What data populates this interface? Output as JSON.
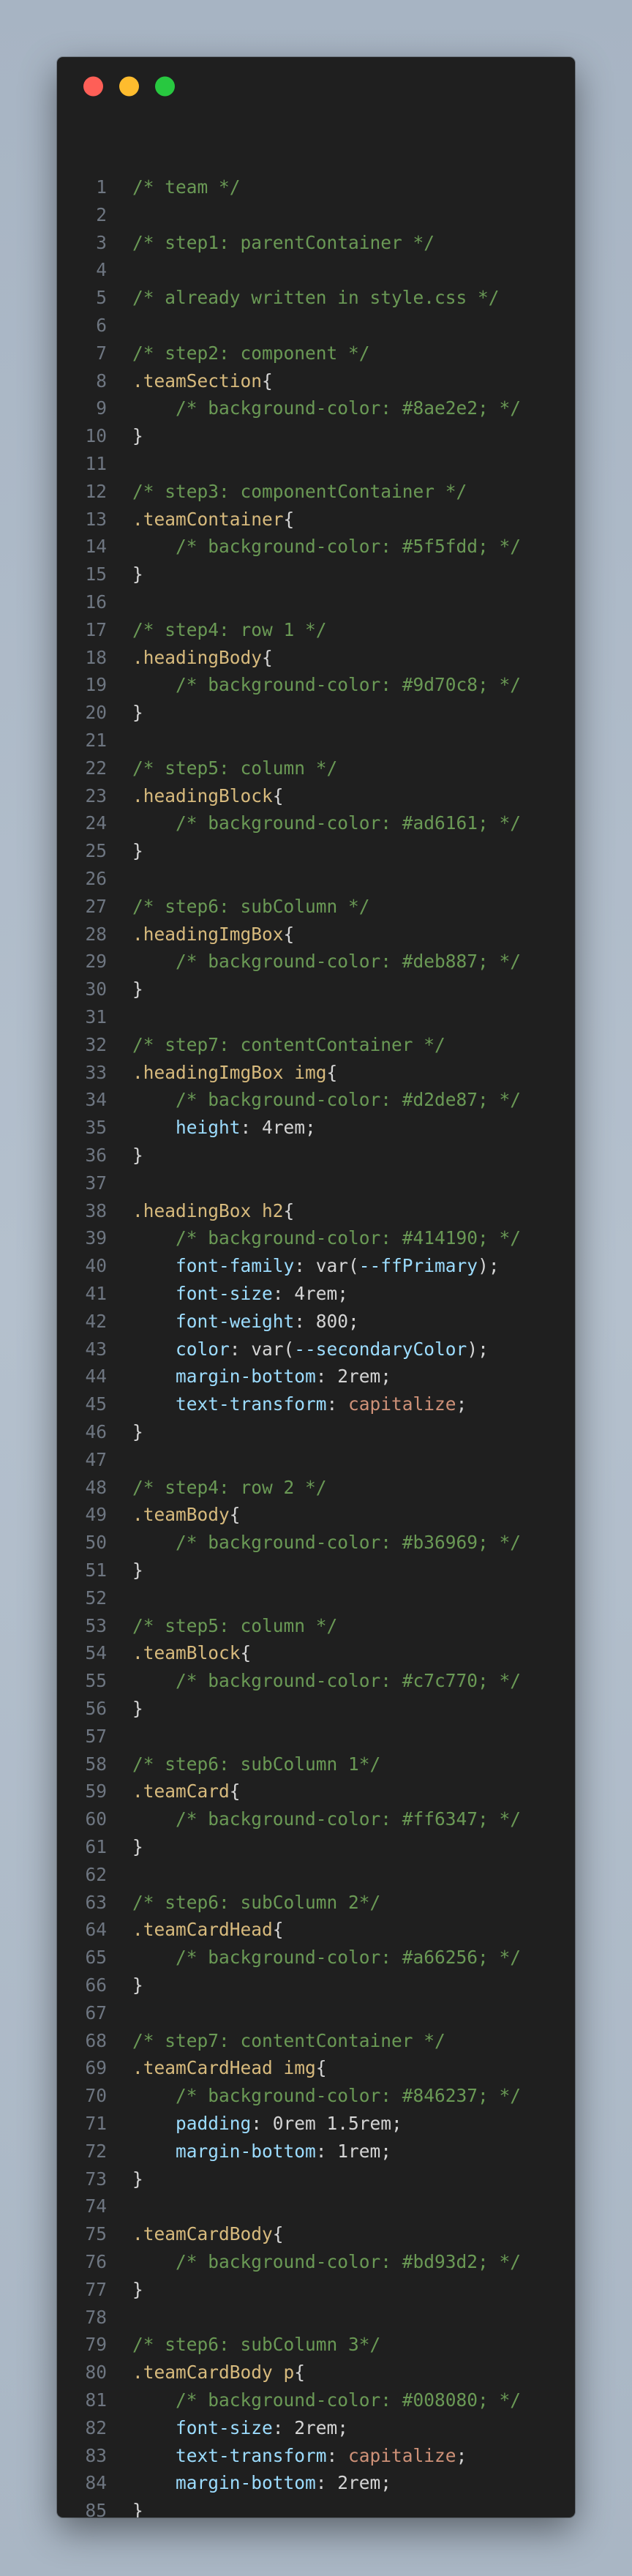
{
  "window": {
    "controls": [
      {
        "name": "close",
        "color": "#fe5f57"
      },
      {
        "name": "minimize",
        "color": "#febc2e"
      },
      {
        "name": "maximize",
        "color": "#28c840"
      }
    ]
  },
  "colors": {
    "comment": "#6a9955",
    "selector": "#d7ba7d",
    "property": "#9cdcfe",
    "keyword": "#ce9178",
    "text": "#d4d4d4",
    "line_number": "#6e7681"
  },
  "code": {
    "lines": [
      {
        "n": "1",
        "tokens": [
          {
            "t": "/* team */",
            "c": "comment"
          }
        ]
      },
      {
        "n": "2",
        "tokens": []
      },
      {
        "n": "3",
        "tokens": [
          {
            "t": "/* step1: parentContainer */",
            "c": "comment"
          }
        ]
      },
      {
        "n": "4",
        "tokens": []
      },
      {
        "n": "5",
        "tokens": [
          {
            "t": "/* already written in style.css */",
            "c": "comment"
          }
        ]
      },
      {
        "n": "6",
        "tokens": []
      },
      {
        "n": "7",
        "tokens": [
          {
            "t": "/* step2: component */",
            "c": "comment"
          }
        ]
      },
      {
        "n": "8",
        "tokens": [
          {
            "t": ".teamSection",
            "c": "selector"
          },
          {
            "t": "{",
            "c": "brace"
          }
        ]
      },
      {
        "n": "9",
        "tokens": [
          {
            "t": "    ",
            "c": "punct"
          },
          {
            "t": "/* background-color: #8ae2e2; */",
            "c": "comment"
          }
        ]
      },
      {
        "n": "10",
        "tokens": [
          {
            "t": "}",
            "c": "brace"
          }
        ]
      },
      {
        "n": "11",
        "tokens": []
      },
      {
        "n": "12",
        "tokens": [
          {
            "t": "/* step3: componentContainer */",
            "c": "comment"
          }
        ]
      },
      {
        "n": "13",
        "tokens": [
          {
            "t": ".teamContainer",
            "c": "selector"
          },
          {
            "t": "{",
            "c": "brace"
          }
        ]
      },
      {
        "n": "14",
        "tokens": [
          {
            "t": "    ",
            "c": "punct"
          },
          {
            "t": "/* background-color: #5f5fdd; */",
            "c": "comment"
          }
        ]
      },
      {
        "n": "15",
        "tokens": [
          {
            "t": "}",
            "c": "brace"
          }
        ]
      },
      {
        "n": "16",
        "tokens": []
      },
      {
        "n": "17",
        "tokens": [
          {
            "t": "/* step4: row 1 */",
            "c": "comment"
          }
        ]
      },
      {
        "n": "18",
        "tokens": [
          {
            "t": ".headingBody",
            "c": "selector"
          },
          {
            "t": "{",
            "c": "brace"
          }
        ]
      },
      {
        "n": "19",
        "tokens": [
          {
            "t": "    ",
            "c": "punct"
          },
          {
            "t": "/* background-color: #9d70c8; */",
            "c": "comment"
          }
        ]
      },
      {
        "n": "20",
        "tokens": [
          {
            "t": "}",
            "c": "brace"
          }
        ]
      },
      {
        "n": "21",
        "tokens": []
      },
      {
        "n": "22",
        "tokens": [
          {
            "t": "/* step5: column */",
            "c": "comment"
          }
        ]
      },
      {
        "n": "23",
        "tokens": [
          {
            "t": ".headingBlock",
            "c": "selector"
          },
          {
            "t": "{",
            "c": "brace"
          }
        ]
      },
      {
        "n": "24",
        "tokens": [
          {
            "t": "    ",
            "c": "punct"
          },
          {
            "t": "/* background-color: #ad6161; */",
            "c": "comment"
          }
        ]
      },
      {
        "n": "25",
        "tokens": [
          {
            "t": "}",
            "c": "brace"
          }
        ]
      },
      {
        "n": "26",
        "tokens": []
      },
      {
        "n": "27",
        "tokens": [
          {
            "t": "/* step6: subColumn */",
            "c": "comment"
          }
        ]
      },
      {
        "n": "28",
        "tokens": [
          {
            "t": ".headingImgBox",
            "c": "selector"
          },
          {
            "t": "{",
            "c": "brace"
          }
        ]
      },
      {
        "n": "29",
        "tokens": [
          {
            "t": "    ",
            "c": "punct"
          },
          {
            "t": "/* background-color: #deb887; */",
            "c": "comment"
          }
        ]
      },
      {
        "n": "30",
        "tokens": [
          {
            "t": "}",
            "c": "brace"
          }
        ]
      },
      {
        "n": "31",
        "tokens": []
      },
      {
        "n": "32",
        "tokens": [
          {
            "t": "/* step7: contentContainer */",
            "c": "comment"
          }
        ]
      },
      {
        "n": "33",
        "tokens": [
          {
            "t": ".headingImgBox img",
            "c": "selector"
          },
          {
            "t": "{",
            "c": "brace"
          }
        ]
      },
      {
        "n": "34",
        "tokens": [
          {
            "t": "    ",
            "c": "punct"
          },
          {
            "t": "/* background-color: #d2de87; */",
            "c": "comment"
          }
        ]
      },
      {
        "n": "35",
        "tokens": [
          {
            "t": "    ",
            "c": "punct"
          },
          {
            "t": "height",
            "c": "prop"
          },
          {
            "t": ": 4rem;",
            "c": "value"
          }
        ]
      },
      {
        "n": "36",
        "tokens": [
          {
            "t": "}",
            "c": "brace"
          }
        ]
      },
      {
        "n": "37",
        "tokens": []
      },
      {
        "n": "38",
        "tokens": [
          {
            "t": ".headingBox h2",
            "c": "selector"
          },
          {
            "t": "{",
            "c": "brace"
          }
        ]
      },
      {
        "n": "39",
        "tokens": [
          {
            "t": "    ",
            "c": "punct"
          },
          {
            "t": "/* background-color: #414190; */",
            "c": "comment"
          }
        ]
      },
      {
        "n": "40",
        "tokens": [
          {
            "t": "    ",
            "c": "punct"
          },
          {
            "t": "font-family",
            "c": "prop"
          },
          {
            "t": ": var(",
            "c": "value"
          },
          {
            "t": "--ffPrimary",
            "c": "var"
          },
          {
            "t": ");",
            "c": "value"
          }
        ]
      },
      {
        "n": "41",
        "tokens": [
          {
            "t": "    ",
            "c": "punct"
          },
          {
            "t": "font-size",
            "c": "prop"
          },
          {
            "t": ": 4rem;",
            "c": "value"
          }
        ]
      },
      {
        "n": "42",
        "tokens": [
          {
            "t": "    ",
            "c": "punct"
          },
          {
            "t": "font-weight",
            "c": "prop"
          },
          {
            "t": ": 800;",
            "c": "value"
          }
        ]
      },
      {
        "n": "43",
        "tokens": [
          {
            "t": "    ",
            "c": "punct"
          },
          {
            "t": "color",
            "c": "prop"
          },
          {
            "t": ": var(",
            "c": "value"
          },
          {
            "t": "--secondaryColor",
            "c": "var"
          },
          {
            "t": ");",
            "c": "value"
          }
        ]
      },
      {
        "n": "44",
        "tokens": [
          {
            "t": "    ",
            "c": "punct"
          },
          {
            "t": "margin-bottom",
            "c": "prop"
          },
          {
            "t": ": 2rem;",
            "c": "value"
          }
        ]
      },
      {
        "n": "45",
        "tokens": [
          {
            "t": "    ",
            "c": "punct"
          },
          {
            "t": "text-transform",
            "c": "prop"
          },
          {
            "t": ": ",
            "c": "value"
          },
          {
            "t": "capitalize",
            "c": "keyword"
          },
          {
            "t": ";",
            "c": "value"
          }
        ]
      },
      {
        "n": "46",
        "tokens": [
          {
            "t": "}",
            "c": "brace"
          }
        ]
      },
      {
        "n": "47",
        "tokens": []
      },
      {
        "n": "48",
        "tokens": [
          {
            "t": "/* step4: row 2 */",
            "c": "comment"
          }
        ]
      },
      {
        "n": "49",
        "tokens": [
          {
            "t": ".teamBody",
            "c": "selector"
          },
          {
            "t": "{",
            "c": "brace"
          }
        ]
      },
      {
        "n": "50",
        "tokens": [
          {
            "t": "    ",
            "c": "punct"
          },
          {
            "t": "/* background-color: #b36969; */",
            "c": "comment"
          }
        ]
      },
      {
        "n": "51",
        "tokens": [
          {
            "t": "}",
            "c": "brace"
          }
        ]
      },
      {
        "n": "52",
        "tokens": []
      },
      {
        "n": "53",
        "tokens": [
          {
            "t": "/* step5: column */",
            "c": "comment"
          }
        ]
      },
      {
        "n": "54",
        "tokens": [
          {
            "t": ".teamBlock",
            "c": "selector"
          },
          {
            "t": "{",
            "c": "brace"
          }
        ]
      },
      {
        "n": "55",
        "tokens": [
          {
            "t": "    ",
            "c": "punct"
          },
          {
            "t": "/* background-color: #c7c770; */",
            "c": "comment"
          }
        ]
      },
      {
        "n": "56",
        "tokens": [
          {
            "t": "}",
            "c": "brace"
          }
        ]
      },
      {
        "n": "57",
        "tokens": []
      },
      {
        "n": "58",
        "tokens": [
          {
            "t": "/* step6: subColumn 1*/",
            "c": "comment"
          }
        ]
      },
      {
        "n": "59",
        "tokens": [
          {
            "t": ".teamCard",
            "c": "selector"
          },
          {
            "t": "{",
            "c": "brace"
          }
        ]
      },
      {
        "n": "60",
        "tokens": [
          {
            "t": "    ",
            "c": "punct"
          },
          {
            "t": "/* background-color: #ff6347; */",
            "c": "comment"
          }
        ]
      },
      {
        "n": "61",
        "tokens": [
          {
            "t": "}",
            "c": "brace"
          }
        ]
      },
      {
        "n": "62",
        "tokens": []
      },
      {
        "n": "63",
        "tokens": [
          {
            "t": "/* step6: subColumn 2*/",
            "c": "comment"
          }
        ]
      },
      {
        "n": "64",
        "tokens": [
          {
            "t": ".teamCardHead",
            "c": "selector"
          },
          {
            "t": "{",
            "c": "brace"
          }
        ]
      },
      {
        "n": "65",
        "tokens": [
          {
            "t": "    ",
            "c": "punct"
          },
          {
            "t": "/* background-color: #a66256; */",
            "c": "comment"
          }
        ]
      },
      {
        "n": "66",
        "tokens": [
          {
            "t": "}",
            "c": "brace"
          }
        ]
      },
      {
        "n": "67",
        "tokens": []
      },
      {
        "n": "68",
        "tokens": [
          {
            "t": "/* step7: contentContainer */",
            "c": "comment"
          }
        ]
      },
      {
        "n": "69",
        "tokens": [
          {
            "t": ".teamCardHead img",
            "c": "selector"
          },
          {
            "t": "{",
            "c": "brace"
          }
        ]
      },
      {
        "n": "70",
        "tokens": [
          {
            "t": "    ",
            "c": "punct"
          },
          {
            "t": "/* background-color: #846237; */",
            "c": "comment"
          }
        ]
      },
      {
        "n": "71",
        "tokens": [
          {
            "t": "    ",
            "c": "punct"
          },
          {
            "t": "padding",
            "c": "prop"
          },
          {
            "t": ": 0rem 1.5rem;",
            "c": "value"
          }
        ]
      },
      {
        "n": "72",
        "tokens": [
          {
            "t": "    ",
            "c": "punct"
          },
          {
            "t": "margin-bottom",
            "c": "prop"
          },
          {
            "t": ": 1rem;",
            "c": "value"
          }
        ]
      },
      {
        "n": "73",
        "tokens": [
          {
            "t": "}",
            "c": "brace"
          }
        ]
      },
      {
        "n": "74",
        "tokens": []
      },
      {
        "n": "75",
        "tokens": [
          {
            "t": ".teamCardBody",
            "c": "selector"
          },
          {
            "t": "{",
            "c": "brace"
          }
        ]
      },
      {
        "n": "76",
        "tokens": [
          {
            "t": "    ",
            "c": "punct"
          },
          {
            "t": "/* background-color: #bd93d2; */",
            "c": "comment"
          }
        ]
      },
      {
        "n": "77",
        "tokens": [
          {
            "t": "}",
            "c": "brace"
          }
        ]
      },
      {
        "n": "78",
        "tokens": []
      },
      {
        "n": "79",
        "tokens": [
          {
            "t": "/* step6: subColumn 3*/",
            "c": "comment"
          }
        ]
      },
      {
        "n": "80",
        "tokens": [
          {
            "t": ".teamCardBody p",
            "c": "selector"
          },
          {
            "t": "{",
            "c": "brace"
          }
        ]
      },
      {
        "n": "81",
        "tokens": [
          {
            "t": "    ",
            "c": "punct"
          },
          {
            "t": "/* background-color: #008080; */",
            "c": "comment"
          }
        ]
      },
      {
        "n": "82",
        "tokens": [
          {
            "t": "    ",
            "c": "punct"
          },
          {
            "t": "font-size",
            "c": "prop"
          },
          {
            "t": ": 2rem;",
            "c": "value"
          }
        ]
      },
      {
        "n": "83",
        "tokens": [
          {
            "t": "    ",
            "c": "punct"
          },
          {
            "t": "text-transform",
            "c": "prop"
          },
          {
            "t": ": ",
            "c": "value"
          },
          {
            "t": "capitalize",
            "c": "keyword"
          },
          {
            "t": ";",
            "c": "value"
          }
        ]
      },
      {
        "n": "84",
        "tokens": [
          {
            "t": "    ",
            "c": "punct"
          },
          {
            "t": "margin-bottom",
            "c": "prop"
          },
          {
            "t": ": 2rem;",
            "c": "value"
          }
        ]
      },
      {
        "n": "85",
        "tokens": [
          {
            "t": "}",
            "c": "brace"
          }
        ]
      }
    ]
  }
}
